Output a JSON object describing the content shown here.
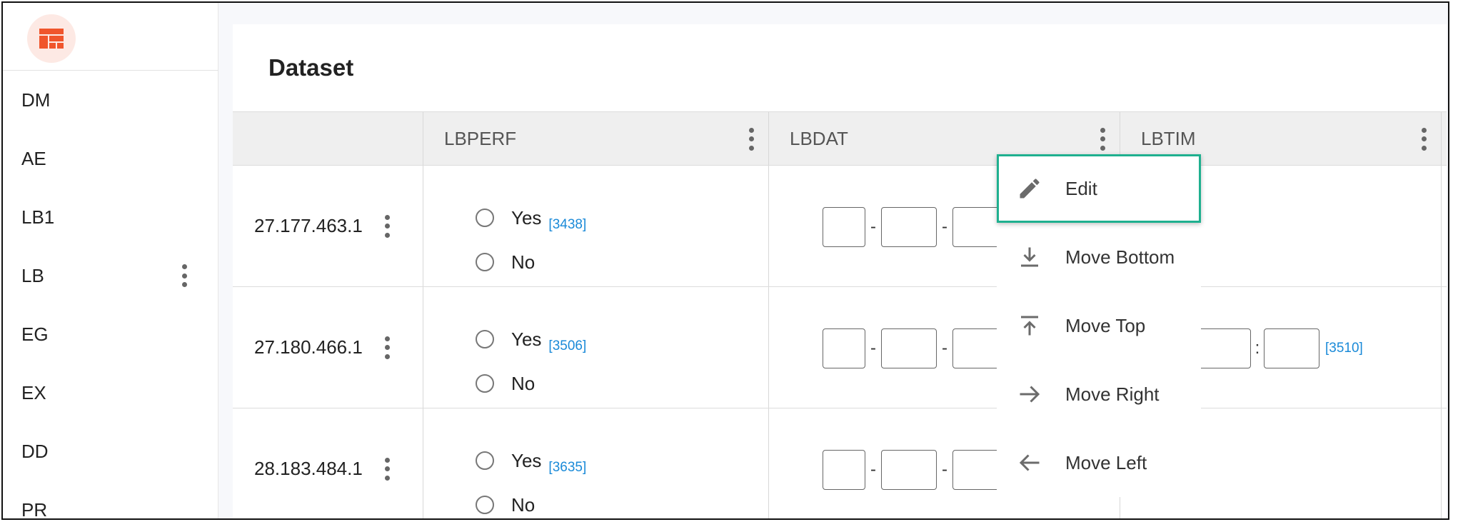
{
  "app": {
    "logo_icon": "table-layout-icon",
    "accent": "#f0552c"
  },
  "sidebar": {
    "items": [
      {
        "label": "DM"
      },
      {
        "label": "AE"
      },
      {
        "label": "LB1"
      },
      {
        "label": "LB"
      },
      {
        "label": "EG"
      },
      {
        "label": "EX"
      },
      {
        "label": "DD"
      },
      {
        "label": "PR"
      }
    ]
  },
  "main": {
    "title": "Dataset",
    "columns": [
      {
        "label": "LBPERF"
      },
      {
        "label": "LBDAT"
      },
      {
        "label": "LBTIM"
      }
    ],
    "rows": [
      {
        "id": "27.177.463.1",
        "yes": "Yes",
        "no": "No",
        "ref": "[3438]",
        "time_ref": ""
      },
      {
        "id": "27.180.466.1",
        "yes": "Yes",
        "no": "No",
        "ref": "[3506]",
        "time_ref": "[3510]"
      },
      {
        "id": "28.183.484.1",
        "yes": "Yes",
        "no": "No",
        "ref": "[3635]",
        "time_ref": ""
      }
    ],
    "date_sep": "-",
    "time_sep": ":"
  },
  "context_menu": {
    "highlight_color": "#1fb08f",
    "items": [
      {
        "label": "Edit",
        "icon": "pencil-icon"
      },
      {
        "label": "Move Bottom",
        "icon": "arrow-to-bottom-icon"
      },
      {
        "label": "Move Top",
        "icon": "arrow-to-top-icon"
      },
      {
        "label": "Move Right",
        "icon": "arrow-right-icon"
      },
      {
        "label": "Move Left",
        "icon": "arrow-left-icon"
      }
    ]
  }
}
